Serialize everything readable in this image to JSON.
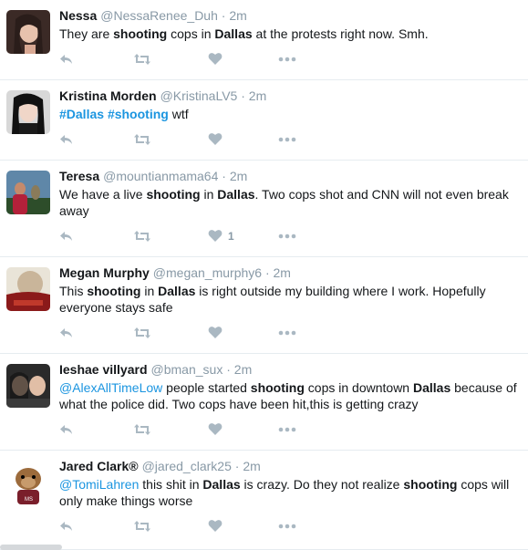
{
  "icons": {
    "reply": "reply-icon",
    "retweet": "retweet-icon",
    "like": "heart-icon",
    "more": "more-icon"
  },
  "colors": {
    "link": "#1b95e0",
    "muted": "#8899a6",
    "text": "#14171a",
    "border": "#e6ecf0"
  },
  "tweets": [
    {
      "name": "Nessa",
      "handle": "@NessaRenee_Duh",
      "dot": "·",
      "time": "2m",
      "parts": [
        {
          "t": "They are "
        },
        {
          "t": "shooting",
          "s": "b"
        },
        {
          "t": " cops in "
        },
        {
          "t": "Dallas",
          "s": "b"
        },
        {
          "t": " at the protests right now. Smh."
        }
      ],
      "likes": ""
    },
    {
      "name": "Kristina Morden",
      "handle": "@KristinaLV5",
      "dot": "·",
      "time": "2m",
      "parts": [
        {
          "t": "#Dallas",
          "s": "h"
        },
        {
          "t": " "
        },
        {
          "t": "#shooting",
          "s": "h"
        },
        {
          "t": " wtf"
        }
      ],
      "likes": ""
    },
    {
      "name": "Teresa",
      "handle": "@mountianmama64",
      "dot": "·",
      "time": "2m",
      "parts": [
        {
          "t": "We have a live "
        },
        {
          "t": "shooting",
          "s": "b"
        },
        {
          "t": " in "
        },
        {
          "t": "Dallas",
          "s": "b"
        },
        {
          "t": ". Two cops shot and CNN will not even break away"
        }
      ],
      "likes": "1"
    },
    {
      "name": "Megan Murphy",
      "handle": "@megan_murphy6",
      "dot": "·",
      "time": "2m",
      "parts": [
        {
          "t": "This "
        },
        {
          "t": "shooting",
          "s": "b"
        },
        {
          "t": " in "
        },
        {
          "t": "Dallas",
          "s": "b"
        },
        {
          "t": " is right outside my building where I work. Hopefully everyone stays safe"
        }
      ],
      "likes": ""
    },
    {
      "name": "Ieshae villyard",
      "handle": "@bman_sux",
      "dot": "·",
      "time": "2m",
      "parts": [
        {
          "t": "@AlexAllTimeLow",
          "s": "l"
        },
        {
          "t": " people started "
        },
        {
          "t": "shooting",
          "s": "b"
        },
        {
          "t": " cops in downtown "
        },
        {
          "t": "Dallas",
          "s": "b"
        },
        {
          "t": " because of what the police did. Two cops have been hit,this is getting crazy"
        }
      ],
      "likes": ""
    },
    {
      "name": "Jared Clark®",
      "handle": "@jared_clark25",
      "dot": "·",
      "time": "2m",
      "parts": [
        {
          "t": "@TomiLahren",
          "s": "l"
        },
        {
          "t": " this shit in "
        },
        {
          "t": "Dallas",
          "s": "b"
        },
        {
          "t": " is crazy. Do they not realize "
        },
        {
          "t": "shooting",
          "s": "b"
        },
        {
          "t": " cops will only make things worse"
        }
      ],
      "likes": ""
    }
  ]
}
